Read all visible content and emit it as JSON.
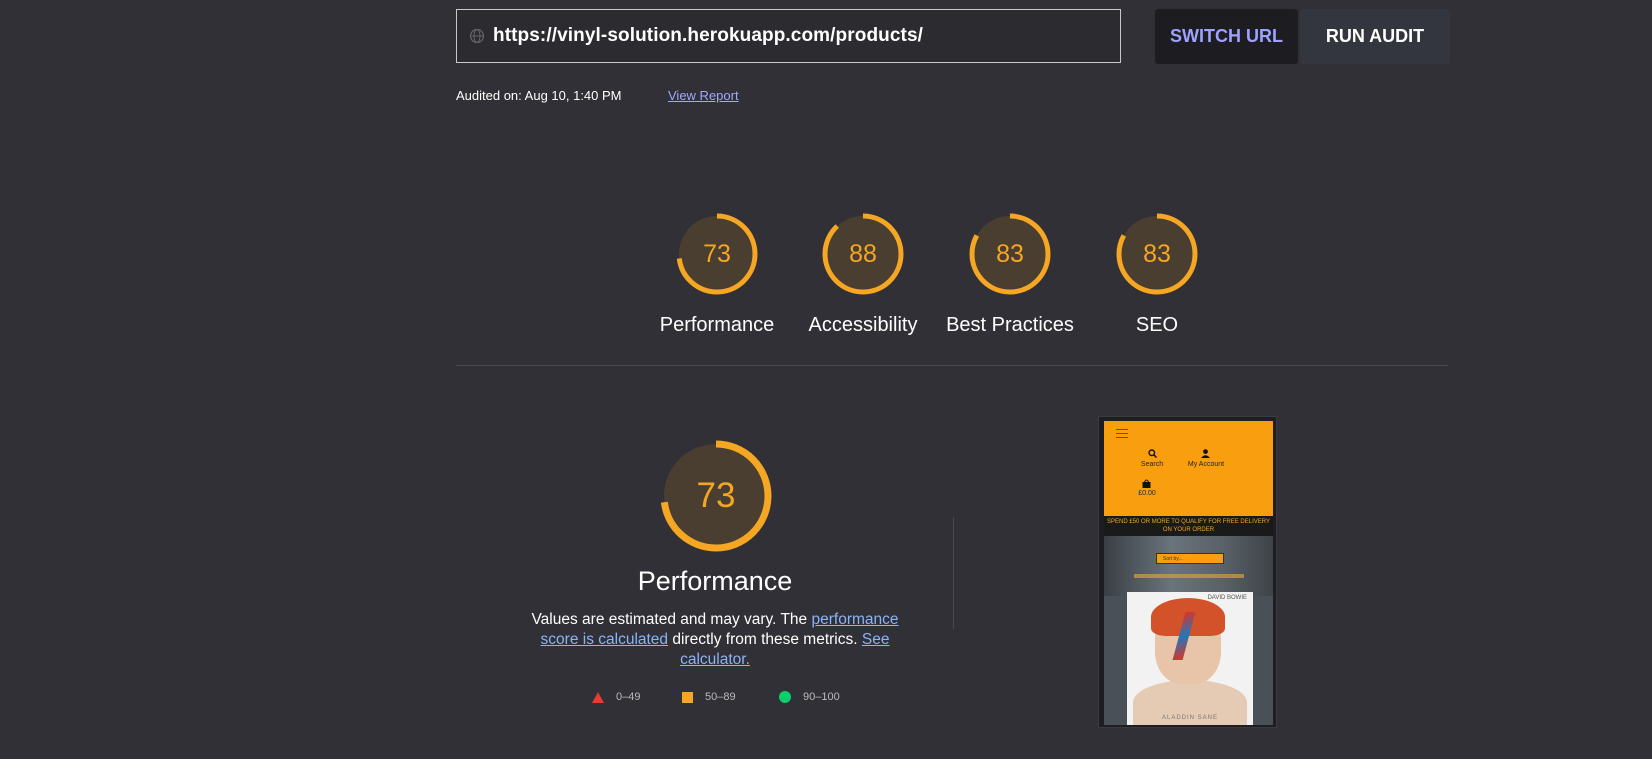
{
  "url_bar": {
    "value": "https://vinyl-solution.herokuapp.com/products/"
  },
  "buttons": {
    "switch_url": "SWITCH URL",
    "run_audit": "RUN AUDIT"
  },
  "audit_info": {
    "audited_on": "Audited on: Aug 10, 1:40 PM",
    "view_report": "View Report"
  },
  "scores": [
    {
      "label": "Performance",
      "value": 73
    },
    {
      "label": "Accessibility",
      "value": 88
    },
    {
      "label": "Best Practices",
      "value": 83
    },
    {
      "label": "SEO",
      "value": 83
    }
  ],
  "performance": {
    "score": 73,
    "title": "Performance",
    "desc_1": "Values are estimated and may vary. The ",
    "desc_link_1": "performance score is calculated",
    "desc_2": " directly from these metrics. ",
    "desc_link_2": "See calculator."
  },
  "legend": [
    {
      "range": "0–49",
      "color": "#eb3a2f",
      "shape": "triangle"
    },
    {
      "range": "50–89",
      "color": "#f5a623",
      "shape": "square"
    },
    {
      "range": "90–100",
      "color": "#0cce6b",
      "shape": "circle"
    }
  ],
  "thumbnail": {
    "search": "Search",
    "account": "My Account",
    "cart": "£0.00",
    "banner": "SPEND £50 OR MORE TO QUALIFY FOR FREE DELIVERY ON YOUR ORDER",
    "sort": "Sort by...",
    "artist": "DAVID BOWIE",
    "album": "ALADDIN SANE"
  },
  "colors": {
    "average": "#f5a623",
    "gauge_bg": "#4a3e30",
    "background": "#303036",
    "link": "#8ab4f8"
  }
}
